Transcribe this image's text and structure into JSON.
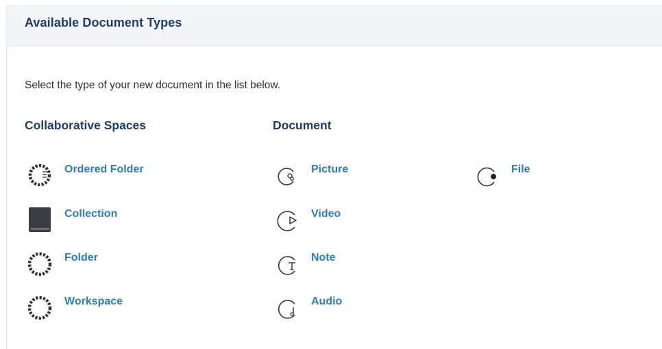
{
  "header": {
    "title": "Available Document Types"
  },
  "intro": "Select the type of your new document in the list below.",
  "columns": [
    {
      "heading": "Collaborative Spaces",
      "items": [
        {
          "label": "Ordered Folder",
          "icon": "ordered-folder-icon"
        },
        {
          "label": "Collection",
          "icon": "collection-icon"
        },
        {
          "label": "Folder",
          "icon": "folder-icon"
        },
        {
          "label": "Workspace",
          "icon": "workspace-icon"
        }
      ]
    },
    {
      "heading": "Document",
      "items": [
        {
          "label": "Picture",
          "icon": "picture-icon"
        },
        {
          "label": "Video",
          "icon": "video-icon"
        },
        {
          "label": "Note",
          "icon": "note-icon"
        },
        {
          "label": "Audio",
          "icon": "audio-icon"
        }
      ]
    },
    {
      "heading": "",
      "items": [
        {
          "label": "File",
          "icon": "file-icon"
        }
      ]
    }
  ],
  "colors": {
    "title": "#1f3c6e",
    "link": "#2b7ec1",
    "header_bg": "#f3f5f9",
    "icon": "#333333"
  }
}
